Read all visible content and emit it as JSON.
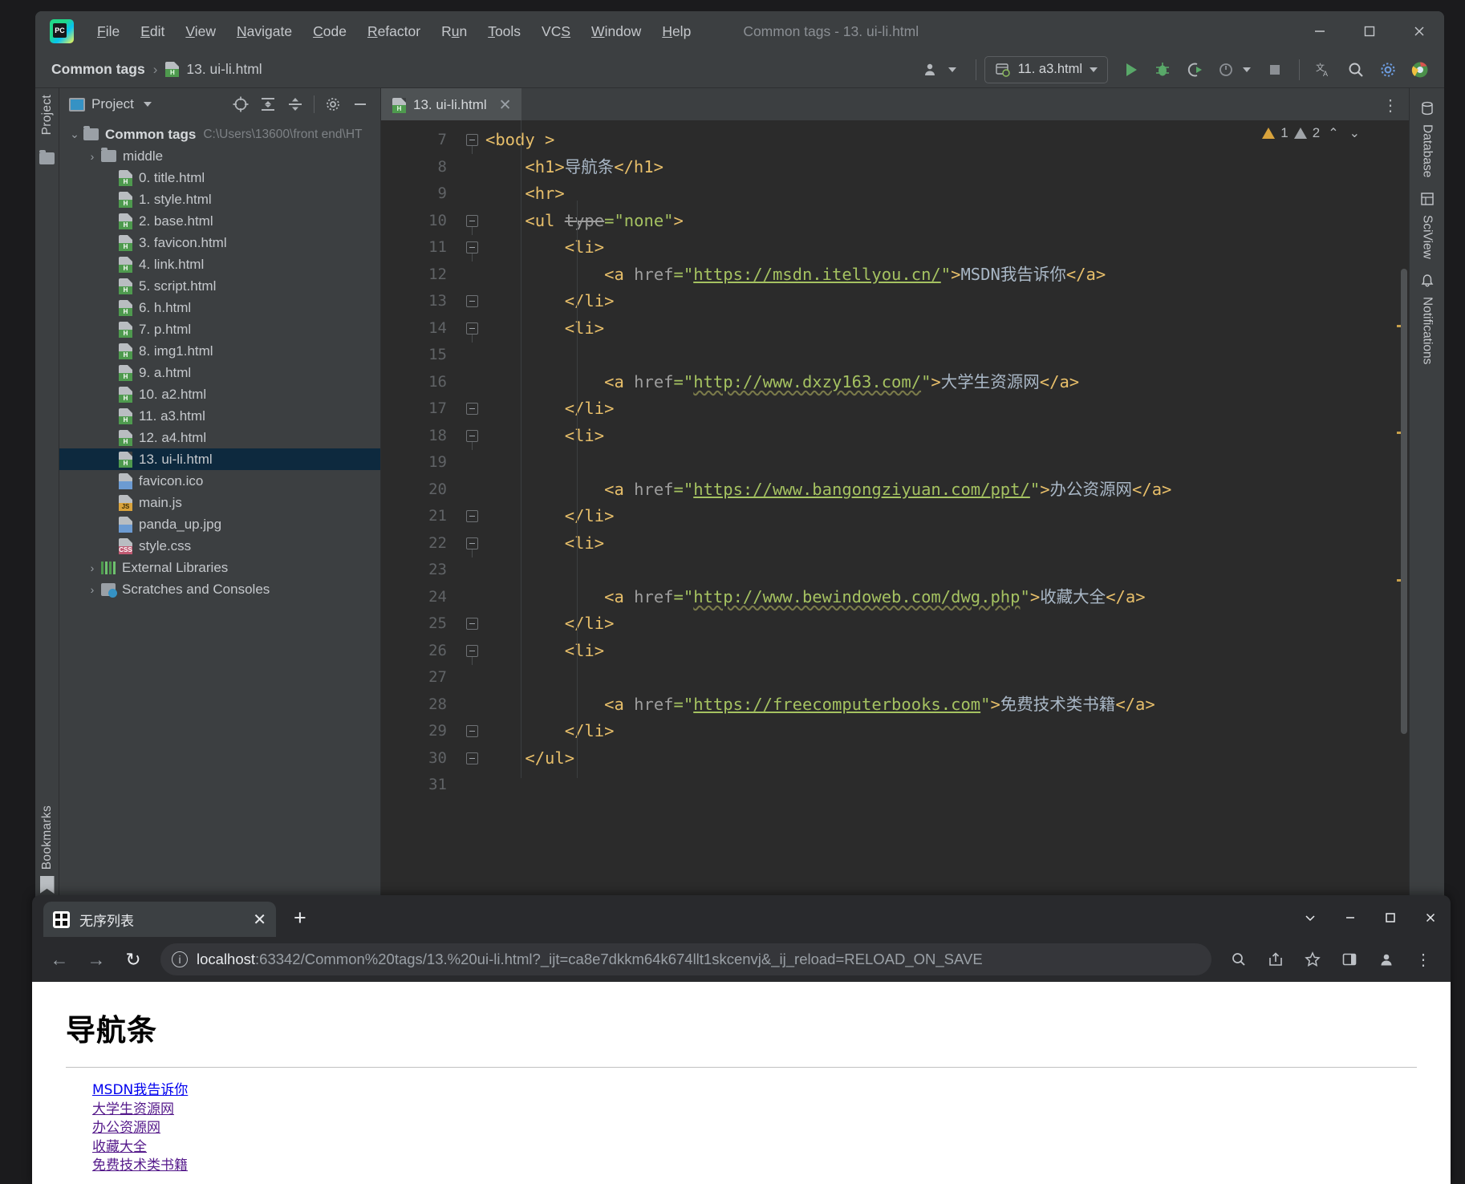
{
  "ide": {
    "window_title": "Common tags - 13. ui-li.html",
    "menu": [
      {
        "pre": "",
        "u": "F",
        "post": "ile"
      },
      {
        "pre": "",
        "u": "E",
        "post": "dit"
      },
      {
        "pre": "",
        "u": "V",
        "post": "iew"
      },
      {
        "pre": "",
        "u": "N",
        "post": "avigate"
      },
      {
        "pre": "",
        "u": "C",
        "post": "ode"
      },
      {
        "pre": "",
        "u": "R",
        "post": "efactor"
      },
      {
        "pre": "R",
        "u": "u",
        "post": "n"
      },
      {
        "pre": "",
        "u": "T",
        "post": "ools"
      },
      {
        "pre": "VC",
        "u": "S",
        "post": ""
      },
      {
        "pre": "",
        "u": "W",
        "post": "indow"
      },
      {
        "pre": "",
        "u": "H",
        "post": "elp"
      }
    ],
    "breadcrumb": {
      "project": "Common tags",
      "separator": "›",
      "file": "13. ui-li.html"
    },
    "toolbar": {
      "run_config": "11. a3.html",
      "run_label": "run-button",
      "debug_label": "debug-button"
    },
    "project_panel": {
      "title": "Project",
      "root": {
        "label": "Common tags",
        "path": "C:\\Users\\13600\\front end\\HT"
      },
      "items": [
        {
          "label": "middle",
          "type": "folder",
          "indent": 1,
          "chev": "›"
        },
        {
          "label": "0. title.html",
          "type": "html",
          "indent": 2
        },
        {
          "label": "1. style.html",
          "type": "html",
          "indent": 2
        },
        {
          "label": "2. base.html",
          "type": "html",
          "indent": 2
        },
        {
          "label": "3. favicon.html",
          "type": "html",
          "indent": 2
        },
        {
          "label": "4. link.html",
          "type": "html",
          "indent": 2
        },
        {
          "label": "5. script.html",
          "type": "html",
          "indent": 2
        },
        {
          "label": "6. h.html",
          "type": "html",
          "indent": 2
        },
        {
          "label": "7. p.html",
          "type": "html",
          "indent": 2
        },
        {
          "label": "8. img1.html",
          "type": "html",
          "indent": 2
        },
        {
          "label": "9. a.html",
          "type": "html",
          "indent": 2
        },
        {
          "label": "10. a2.html",
          "type": "html",
          "indent": 2
        },
        {
          "label": "11. a3.html",
          "type": "html",
          "indent": 2
        },
        {
          "label": "12. a4.html",
          "type": "html",
          "indent": 2
        },
        {
          "label": "13. ui-li.html",
          "type": "html",
          "indent": 2,
          "selected": true
        },
        {
          "label": "favicon.ico",
          "type": "img",
          "indent": 2
        },
        {
          "label": "main.js",
          "type": "js",
          "indent": 2
        },
        {
          "label": "panda_up.jpg",
          "type": "img",
          "indent": 2
        },
        {
          "label": "style.css",
          "type": "css",
          "indent": 2
        },
        {
          "label": "External Libraries",
          "type": "lib",
          "indent": 1,
          "chev": "›"
        },
        {
          "label": "Scratches and Consoles",
          "type": "scratch",
          "indent": 1,
          "chev": "›"
        }
      ]
    },
    "left_strip": {
      "tabs": [
        "Project"
      ]
    },
    "right_strip": {
      "tabs": [
        "Database",
        "SciView",
        "Notifications"
      ]
    },
    "bookmarks_tab": "Bookmarks",
    "editor": {
      "tab_title": "13. ui-li.html",
      "first_line_number": 7,
      "inspection": {
        "errors": "1",
        "warnings": "2"
      },
      "lines": [
        {
          "n": 7,
          "fold": "minus",
          "code": "<body >"
        },
        {
          "n": 8,
          "fold": "",
          "code": "    <h1>导航条</h1>"
        },
        {
          "n": 9,
          "fold": "",
          "code": "    <hr>"
        },
        {
          "n": 10,
          "fold": "minus",
          "code": "    <ul type=\"none\">"
        },
        {
          "n": 11,
          "fold": "minus",
          "code": "        <li>"
        },
        {
          "n": 12,
          "fold": "",
          "code": "            <a href=\"https://msdn.itellyou.cn/\">MSDN我告诉你</a>"
        },
        {
          "n": 13,
          "fold": "end",
          "code": "        </li>"
        },
        {
          "n": 14,
          "fold": "minus",
          "code": "        <li>"
        },
        {
          "n": 15,
          "fold": "",
          "code": ""
        },
        {
          "n": 16,
          "fold": "",
          "code": "            <a href=\"http://www.dxzy163.com/\">大学生资源网</a>"
        },
        {
          "n": 17,
          "fold": "end",
          "code": "        </li>"
        },
        {
          "n": 18,
          "fold": "minus",
          "code": "        <li>"
        },
        {
          "n": 19,
          "fold": "",
          "code": ""
        },
        {
          "n": 20,
          "fold": "",
          "code": "            <a href=\"https://www.bangongziyuan.com/ppt/\">办公资源网</a>"
        },
        {
          "n": 21,
          "fold": "end",
          "code": "        </li>"
        },
        {
          "n": 22,
          "fold": "minus",
          "code": "        <li>"
        },
        {
          "n": 23,
          "fold": "",
          "code": ""
        },
        {
          "n": 24,
          "fold": "",
          "code": "            <a href=\"http://www.bewindoweb.com/dwg.php\">收藏大全</a>"
        },
        {
          "n": 25,
          "fold": "end",
          "code": "        </li>"
        },
        {
          "n": 26,
          "fold": "minus",
          "code": "        <li>"
        },
        {
          "n": 27,
          "fold": "",
          "code": ""
        },
        {
          "n": 28,
          "fold": "",
          "code": "            <a href=\"https://freecomputerbooks.com\">免费技术类书籍</a>"
        },
        {
          "n": 29,
          "fold": "end",
          "code": "        </li>"
        },
        {
          "n": 30,
          "fold": "end",
          "code": "    </ul>"
        },
        {
          "n": 31,
          "fold": "",
          "code": ""
        }
      ]
    }
  },
  "browser": {
    "tab": {
      "title": "无序列表",
      "close": "✕"
    },
    "new_tab": "+",
    "nav": {
      "back": "←",
      "forward": "→",
      "reload": "↻"
    },
    "omnibox": {
      "host": "localhost",
      "rest": ":63342/Common%20tags/13.%20ui-li.html?_ijt=ca8e7dkkm64k674llt1skcenvj&_ij_reload=RELOAD_ON_SAVE"
    },
    "page": {
      "h1": "导航条",
      "links": [
        {
          "text": "MSDN我告诉你",
          "href": "https://msdn.itellyou.cn/"
        },
        {
          "text": "大学生资源网",
          "href": "http://www.dxzy163.com/"
        },
        {
          "text": "办公资源网",
          "href": "https://www.bangongziyuan.com/ppt/"
        },
        {
          "text": "收藏大全",
          "href": "http://www.bewindoweb.com/dwg.php"
        },
        {
          "text": "免费技术类书籍",
          "href": "https://freecomputerbooks.com"
        }
      ]
    }
  },
  "colors": {
    "ide_chrome": "#3c3f41",
    "editor_bg": "#2b2b2b",
    "selection": "#0d293e",
    "tag": "#e8bf6a",
    "string": "#a5c261",
    "text": "#a9b7c6",
    "accent_green": "#4e9a4e"
  }
}
